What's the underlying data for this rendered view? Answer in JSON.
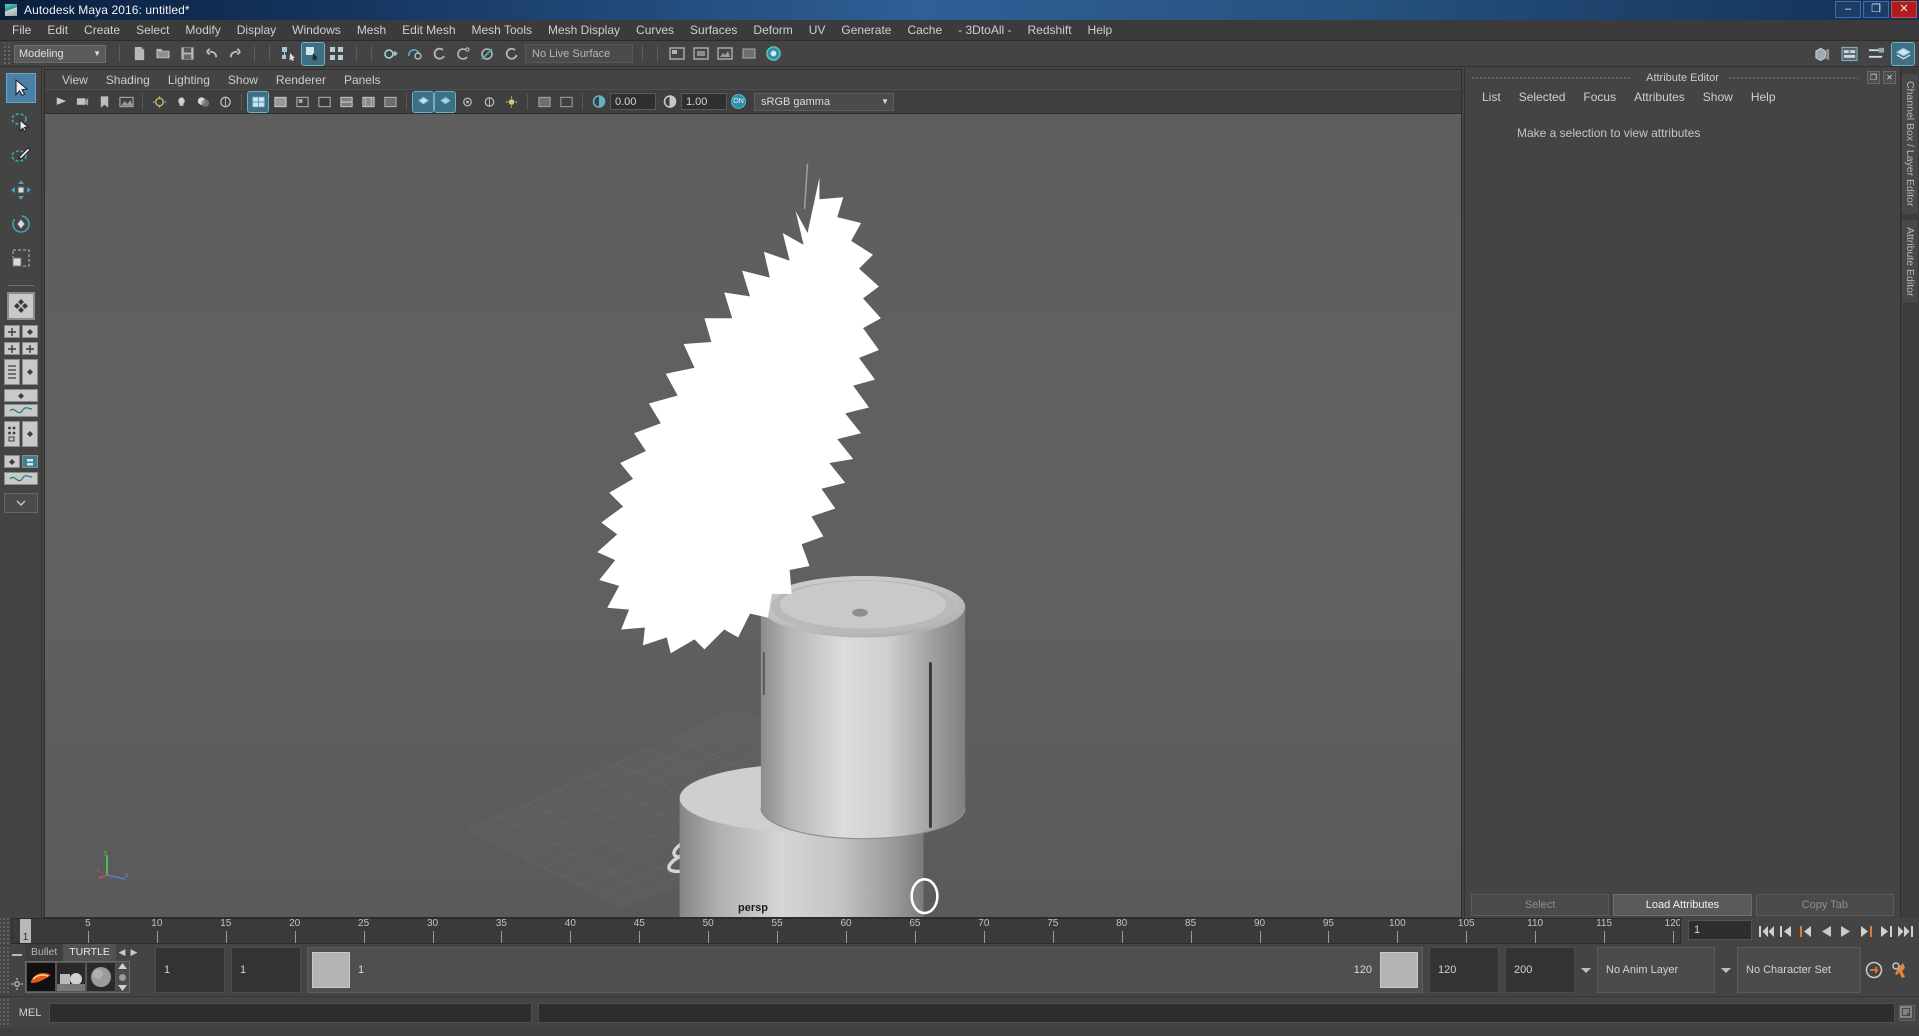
{
  "window": {
    "title": "Autodesk Maya 2016: untitled*",
    "app_icon": "maya-icon",
    "minimize": "–",
    "maximize": "❐",
    "close": "✕"
  },
  "menubar": {
    "items": [
      "File",
      "Edit",
      "Create",
      "Select",
      "Modify",
      "Display",
      "Windows",
      "Mesh",
      "Edit Mesh",
      "Mesh Tools",
      "Mesh Display",
      "Curves",
      "Surfaces",
      "Deform",
      "UV",
      "Generate",
      "Cache",
      "- 3DtoAll -",
      "Redshift",
      "Help"
    ]
  },
  "statusbar": {
    "menuset_value": "Modeling",
    "menuset_caret": "▼",
    "live_surface": "No Live Surface",
    "icons": [
      "new-scene-icon",
      "open-scene-icon",
      "save-scene-icon",
      "undo-icon",
      "redo-icon",
      "select-by-hierarchy-icon",
      "select-by-object-icon",
      "select-by-component-icon",
      "snap-to-grid-icon",
      "snap-to-curve-icon",
      "snap-to-point-icon",
      "snap-to-projected-center-icon",
      "snap-to-view-plane-icon",
      "make-live-icon"
    ],
    "right_icons": [
      "show-hide-modeling-toolkit-icon",
      "show-hide-attribute-editor-icon",
      "show-hide-tool-settings-icon",
      "show-hide-channel-box-icon"
    ]
  },
  "toolbox": {
    "tools": [
      {
        "name": "select-tool",
        "selected": true
      },
      {
        "name": "lasso-select-tool",
        "selected": false
      },
      {
        "name": "paint-select-tool",
        "selected": false
      },
      {
        "name": "move-tool",
        "selected": false
      },
      {
        "name": "rotate-tool",
        "selected": false
      },
      {
        "name": "scale-tool",
        "selected": false
      }
    ],
    "layouts": [
      "single-perspective-layout",
      "four-view-layout",
      "outliner-persp-layout",
      "persp-graph-layout",
      "hypershade-persp-layout",
      "persp-outliner-graph-layout",
      "more-layouts"
    ]
  },
  "viewport": {
    "panelmenu": [
      "View",
      "Shading",
      "Lighting",
      "Show",
      "Renderer",
      "Panels"
    ],
    "toolbar": {
      "exposure_value": "0.00",
      "gamma_value": "1.00",
      "color_management_toggle": "ON",
      "view_transform": "sRGB gamma",
      "view_transform_caret": "▼"
    },
    "camera_label": "persp",
    "axis_labels": {
      "x": "x",
      "y": "y",
      "z": "z"
    },
    "scene_description": "grey cylindrical humidifier model emitting a white mist cloud, sitting on a ground grid plane, with a coiled power cable"
  },
  "attribute_editor": {
    "panel_title": "Attribute Editor",
    "restore_icon": "❐",
    "close_icon": "✕",
    "menu": [
      "List",
      "Selected",
      "Focus",
      "Attributes",
      "Show",
      "Help"
    ],
    "hint": "Make a selection to view attributes",
    "buttons": [
      {
        "label": "Select",
        "active": false
      },
      {
        "label": "Load Attributes",
        "active": true
      },
      {
        "label": "Copy Tab",
        "active": false
      }
    ]
  },
  "right_tabs": [
    "Channel Box / Layer Editor",
    "Attribute Editor"
  ],
  "timeline": {
    "ticks": [
      5,
      10,
      15,
      20,
      25,
      30,
      35,
      40,
      45,
      50,
      55,
      60,
      65,
      70,
      75,
      80,
      85,
      90,
      95,
      100,
      105,
      110,
      115,
      120
    ],
    "current_frame": "1",
    "current_frame_field": "1",
    "range_start": 1,
    "range_end": 120,
    "playback_buttons": [
      "go-to-start-icon",
      "step-back-keyframe-icon",
      "step-back-frame-icon",
      "play-backwards-icon",
      "play-forwards-icon",
      "step-forward-frame-icon",
      "step-forward-keyframe-icon",
      "go-to-end-icon"
    ]
  },
  "range_slider": {
    "shelf_tabs": [
      "Bullet",
      "TURTLE"
    ],
    "shelf_active_tab": "TURTLE",
    "shelf_prev_icon": "◀",
    "shelf_next_icon": "▶",
    "shelf_items": [
      "turtle-render-icon",
      "turtle-bake-icon",
      "turtle-material-icon"
    ],
    "anim_start": "1",
    "playback_start": "1",
    "slider_start_label": "1",
    "slider_end_label": "120",
    "playback_end": "120",
    "anim_end": "200",
    "anim_layer": "No Anim Layer",
    "character_set": "No Character Set",
    "auto_key_icon": "auto-keyframe-icon",
    "anim_prefs_icon": "animation-preferences-icon"
  },
  "command_line": {
    "label": "MEL",
    "input_value": "",
    "output_value": "",
    "script_editor_icon": "script-editor-icon"
  },
  "colors": {
    "accent_blue": "#4a7fa8",
    "toggle_cyan": "#2f8fa8",
    "panel_bg": "#444444",
    "viewport_bg": "#5e5e5e",
    "title_blue": "#2e5f96",
    "orange": "#e07b30"
  }
}
